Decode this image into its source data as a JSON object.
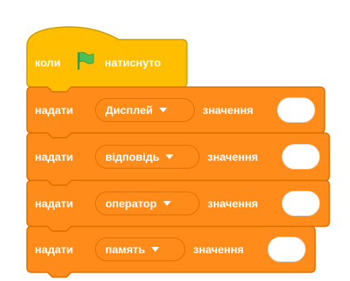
{
  "hat": {
    "label_when": "коли",
    "icon": "green-flag-icon",
    "label_clicked": "натиснуто"
  },
  "blocks": [
    {
      "label_set": "надати",
      "variable": "Дисплей",
      "label_value": "значення",
      "value": ""
    },
    {
      "label_set": "надати",
      "variable": "відповідь",
      "label_value": "значення",
      "value": ""
    },
    {
      "label_set": "надати",
      "variable": "оператор",
      "label_value": "значення",
      "value": ""
    },
    {
      "label_set": "надати",
      "variable": "память",
      "label_value": "значення",
      "value": ""
    }
  ],
  "colors": {
    "events_block": "#ffbf00",
    "variables_block": "#ff8c1a",
    "variables_border": "#db6e00",
    "flag": "#4cbf56"
  }
}
